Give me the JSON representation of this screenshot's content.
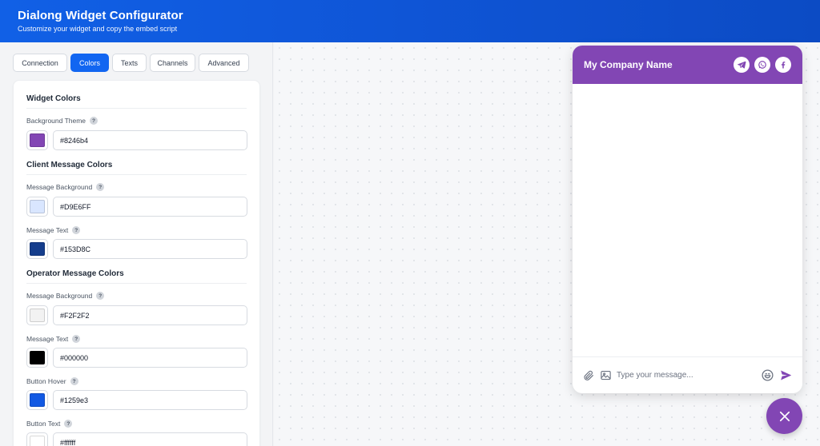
{
  "app": {
    "title": "Dialong Widget Configurator",
    "subtitle": "Customize your widget and copy the embed script"
  },
  "tabs": [
    {
      "label": "Connection",
      "active": false
    },
    {
      "label": "Colors",
      "active": true
    },
    {
      "label": "Texts",
      "active": false
    },
    {
      "label": "Channels",
      "active": false
    },
    {
      "label": "Advanced",
      "active": false
    }
  ],
  "sections": {
    "widget": "Widget Colors",
    "client": "Client Message Colors",
    "operator": "Operator Message Colors"
  },
  "fields": {
    "background_theme": {
      "label": "Background Theme",
      "value": "#8246b4",
      "color": "#8246b4"
    },
    "client_msg_bg": {
      "label": "Message Background",
      "value": "#D9E6FF",
      "color": "#D9E6FF"
    },
    "client_msg_text": {
      "label": "Message Text",
      "value": "#153D8C",
      "color": "#153D8C"
    },
    "operator_msg_bg": {
      "label": "Message Background",
      "value": "#F2F2F2",
      "color": "#F2F2F2"
    },
    "operator_msg_text": {
      "label": "Message Text",
      "value": "#000000",
      "color": "#000000"
    },
    "button_hover": {
      "label": "Button Hover",
      "value": "#1259e3",
      "color": "#1259e3"
    },
    "button_text": {
      "label": "Button Text",
      "value": "#ffffff",
      "color": "#ffffff"
    }
  },
  "help_glyph": "?",
  "widget": {
    "company_name": "My Company Name",
    "header_color": "#8246b4",
    "channels": [
      "telegram-icon",
      "whatsapp-icon",
      "facebook-icon"
    ],
    "input_placeholder": "Type your message..."
  }
}
